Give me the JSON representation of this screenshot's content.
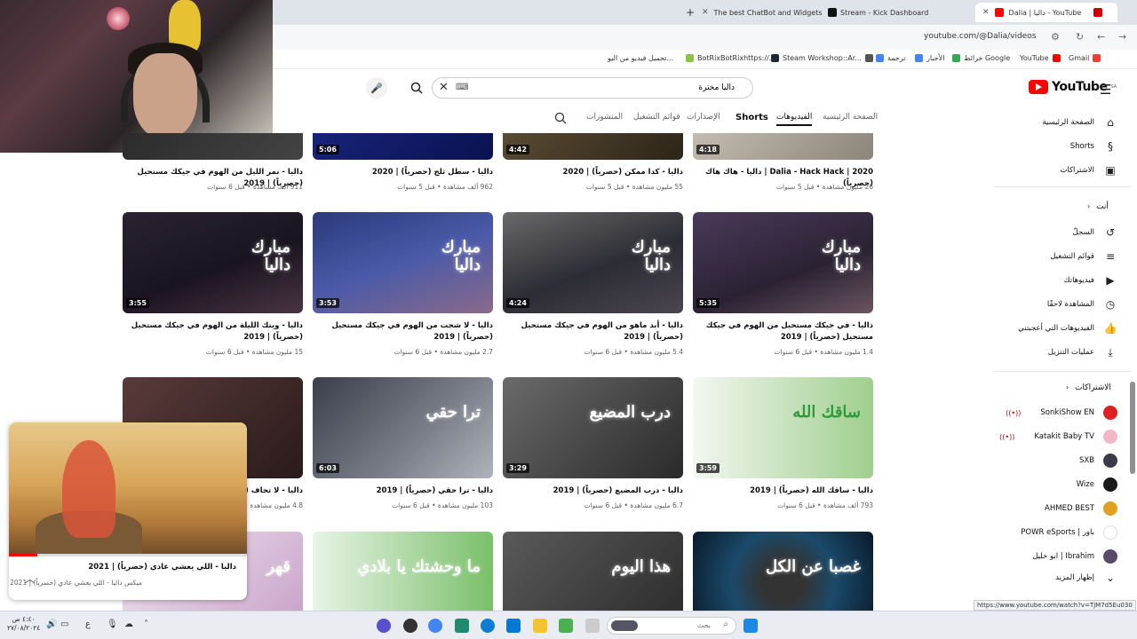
{
  "browser": {
    "tabs": [
      {
        "label": "The best ChatBot and Widgets",
        "fav_color": "#f2f2f2"
      },
      {
        "label": "Stream - Kick Dashboard",
        "fav_color": "#53fc18"
      },
      {
        "label": "Dalia | داليا - YouTube",
        "fav_color": "#ff0000",
        "active": true
      }
    ],
    "new_tab": "+",
    "url": "youtube.com/@Dalia/videos",
    "bookmarks": [
      {
        "label": "Gmail",
        "color": "#ea4335"
      },
      {
        "label": "YouTube",
        "color": "#ff0000"
      },
      {
        "label": "خرائط Google",
        "color": "#34a853"
      },
      {
        "label": "الأخبار",
        "color": "#4285f4"
      },
      {
        "label": "ترجمة",
        "color": "#4285f4"
      },
      {
        "label": "Steam Workshop::Ar...",
        "color": "#1b2838"
      },
      {
        "label": "BotRixBotRixhttps://...",
        "color": "#222"
      },
      {
        "label": "تحميل فيديو من اليو...",
        "color": "#8bc34a"
      }
    ]
  },
  "youtube": {
    "logo_text": "YouTube",
    "logo_sup": "SA",
    "search_value": "داليا مخترة",
    "keyboard_icon": "⌨",
    "channel_tabs": [
      {
        "label": "الصفحة الرئيسية",
        "style": ""
      },
      {
        "label": "الفيديوهات",
        "style": "active"
      },
      {
        "label": "Shorts",
        "style": "bold"
      },
      {
        "label": "الإصدارات",
        "style": ""
      },
      {
        "label": "قوائم التشغيل",
        "style": ""
      },
      {
        "label": "المنشورات",
        "style": ""
      }
    ],
    "videos": [
      {
        "title": "Dalia - Hack Hack | 2020 | داليا - هاك هاك (حصرياً)",
        "meta": "26 مليون مشاهدة • قبل 5 سنوات",
        "duration": "4:18",
        "thumb": "linear-gradient(135deg,#d8d0c4,#8c857a)",
        "thumb_text": ""
      },
      {
        "title": "داليا - كدا ممكن (حصرياً) | 2020",
        "meta": "55 مليون مشاهدة • قبل 5 سنوات",
        "duration": "4:42",
        "thumb": "linear-gradient(135deg,#6a5a3c,#2c2418)",
        "thumb_text": ""
      },
      {
        "title": "داليا - سطل ثلج (حصرياً) | 2020",
        "meta": "962 ألف مشاهدة • قبل 5 سنوات",
        "duration": "5:06",
        "thumb": "linear-gradient(135deg,#1c2a88,#0a1250)",
        "thumb_text": ""
      },
      {
        "title": "داليا - نمر الليل من الهوم في جيكك مستحيل (حصرياً) | 2019",
        "meta": "911 ألف مشاهدة • قبل 6 سنوات",
        "duration": "",
        "thumb": "linear-gradient(135deg,#222,#444)",
        "thumb_text": ""
      },
      {
        "title": "داليا - في جيكك مستحيل من الهوم في جيكك مستحيل (حصرياً) | 2019",
        "meta": "1.4 مليون مشاهدة • قبل 6 سنوات",
        "duration": "5:35",
        "thumb": "linear-gradient(160deg,#4a3a5a,#2a2233 60%,#6b5560)",
        "thumb_text": "مبارك\nداليا"
      },
      {
        "title": "داليا - أبد ماهو من الهوم في جيكك مستحيل (حصرياً) | 2019",
        "meta": "5.4 مليون مشاهدة • قبل 6 سنوات",
        "duration": "4:24",
        "thumb": "linear-gradient(160deg,#6a6a6a,#2c2c34 55%,#4a4650)",
        "thumb_text": "مبارك\nداليا"
      },
      {
        "title": "داليا - لا شجت من الهوم في جيكك مستحيل (حصرياً) | 2019",
        "meta": "2.7 مليون مشاهدة • قبل 6 سنوات",
        "duration": "3:53",
        "thumb": "linear-gradient(160deg,#2a3a7a,#4a5aa8 50%,#8a6a8a)",
        "thumb_text": "مبارك\nداليا"
      },
      {
        "title": "داليا - ويتك الليلة من الهوم في جيكك مستحيل (حصرياً) | 2019",
        "meta": "15 مليون مشاهدة • قبل 6 سنوات",
        "duration": "3:55",
        "thumb": "linear-gradient(160deg,#2a2230,#1a1420 55%,#4a3444)",
        "thumb_text": "مبارك\nداليا"
      },
      {
        "title": "داليا - ساقك الله (حصرياً) | 2019",
        "meta": "793 ألف مشاهدة • قبل 6 سنوات",
        "duration": "3:59",
        "thumb": "linear-gradient(90deg,#f4f7f2,#9fcf8e)",
        "thumb_text": "ساقك الله"
      },
      {
        "title": "داليا - درب المضيع (حصرياً) | 2019",
        "meta": "6.7 مليون مشاهدة • قبل 6 سنوات",
        "duration": "3:29",
        "thumb": "linear-gradient(135deg,#6a6a6a,#2a2a2a)",
        "thumb_text": "درب المضيع"
      },
      {
        "title": "داليا - ترا حقي (حصرياً) | 2019",
        "meta": "103 مليون مشاهدة • قبل 6 سنوات",
        "duration": "6:03",
        "thumb": "linear-gradient(135deg,#3a3e4a,#7a7f8a 60%,#b0b3ba)",
        "thumb_text": "ترا حقي"
      },
      {
        "title": "داليا - لا تحاف (حصرياً) | 2019",
        "meta": "4.8 مليون مشاهدة • قبل 6 سنوات",
        "duration": "",
        "thumb": "linear-gradient(135deg,#5a3a3a,#2a1a1a)",
        "thumb_text": ""
      },
      {
        "title": "",
        "meta": "",
        "duration": "",
        "thumb": "radial-gradient(circle,#333 20%,#1a4a6a 50%,#0a1a2a)",
        "thumb_text": "غصبا عن الكل"
      },
      {
        "title": "",
        "meta": "",
        "duration": "",
        "thumb": "linear-gradient(135deg,#5a5a5a,#2a2a2a)",
        "thumb_text": "هذا اليوم"
      },
      {
        "title": "",
        "meta": "",
        "duration": "",
        "thumb": "linear-gradient(90deg,#e8f4e8,#7ac06a)",
        "thumb_text": "ما وحشتك يا بلادي"
      },
      {
        "title": "",
        "meta": "",
        "duration": "",
        "thumb": "linear-gradient(135deg,#f0e6f0,#c8a0c8)",
        "thumb_text": "قهر"
      }
    ]
  },
  "sidebar": {
    "main": [
      {
        "label": "الصفحة الرئيسية",
        "icon": "home-icon",
        "glyph": "⌂"
      },
      {
        "label": "Shorts",
        "icon": "shorts-icon",
        "glyph": "§"
      },
      {
        "label": "الاشتراكات",
        "icon": "subscriptions-icon",
        "glyph": "▣"
      }
    ],
    "you_head": "أنت",
    "you_items": [
      {
        "label": "السجلّ",
        "icon": "history-icon",
        "glyph": "↺"
      },
      {
        "label": "قوائم التشغيل",
        "icon": "playlists-icon",
        "glyph": "≡"
      },
      {
        "label": "فيديوهاتك",
        "icon": "your-videos-icon",
        "glyph": "▶"
      },
      {
        "label": "المشاهدة لاحقًا",
        "icon": "watch-later-icon",
        "glyph": "◷"
      },
      {
        "label": "الفيديوهات التي أعجبتني",
        "icon": "liked-icon",
        "glyph": "👍"
      },
      {
        "label": "عمليات التنزيل",
        "icon": "downloads-icon",
        "glyph": "⤓"
      }
    ],
    "subs_head": "الاشتراكات",
    "subs": [
      {
        "label": "SonkiShow EN",
        "color": "#e02020",
        "live": true
      },
      {
        "label": "Katakit Baby TV",
        "color": "#f2b8c6",
        "live": true
      },
      {
        "label": "SXB",
        "color": "#3a3a4a",
        "live": false,
        "dot": true
      },
      {
        "label": "Wize",
        "color": "#1a1a1a",
        "live": false
      },
      {
        "label": "AHMED BEST",
        "color": "#e0a020",
        "live": false
      },
      {
        "label": "POWR eSports | باور",
        "color": "#ffffff",
        "live": false
      },
      {
        "label": "ابو خليل | Ibrahim",
        "color": "#5a4a6a",
        "live": false
      }
    ],
    "show_more": "إظهار المزيد"
  },
  "miniplayer": {
    "title": "داليا - اللي يعشي عادي (حصرياً) | 2021",
    "subtitle": "ميكس داليا - اللي يعشي عادي (حصرياً) | 2021",
    "progress": 0.12
  },
  "status_link": "https://www.youtube.com/watch?v=TjM7d5Eu030",
  "taskbar": {
    "search_placeholder": "بحث",
    "time": "٤:٤٠ ص",
    "date": "٢٧/٠٨/٢٠٢٤",
    "lang": "ع"
  }
}
